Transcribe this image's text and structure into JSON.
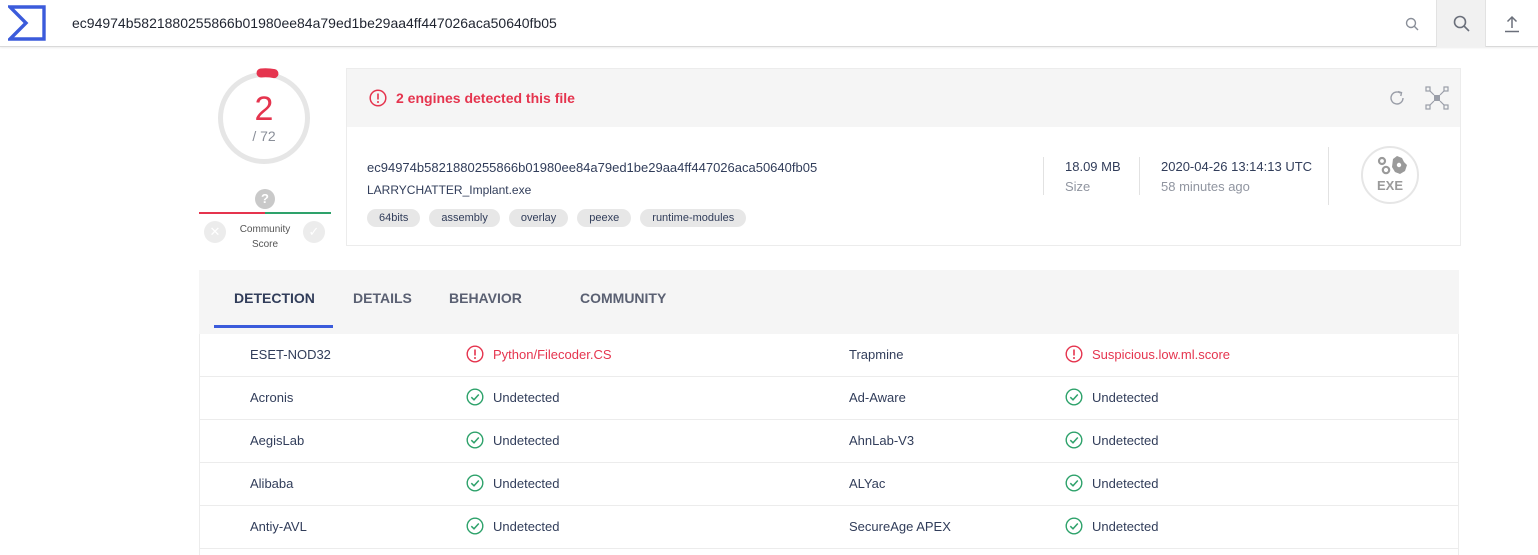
{
  "search": {
    "value": "ec94974b5821880255866b01980ee84a79ed1be29aa4ff447026aca50640fb05"
  },
  "score": {
    "detected": "2",
    "total": "/ 72"
  },
  "community": {
    "label_line1": "Community",
    "label_line2": "Score",
    "unknown": "?"
  },
  "summary": {
    "alert": "2 engines detected this file",
    "hash": "ec94974b5821880255866b01980ee84a79ed1be29aa4ff447026aca50640fb05",
    "filename": "LARRYCHATTER_Implant.exe",
    "tags": [
      "64bits",
      "assembly",
      "overlay",
      "peexe",
      "runtime-modules"
    ],
    "size_value": "18.09 MB",
    "size_label": "Size",
    "date_value": "2020-04-26 13:14:13 UTC",
    "date_label": "58 minutes ago",
    "filetype": "EXE"
  },
  "tabs": [
    "DETECTION",
    "DETAILS",
    "BEHAVIOR",
    "COMMUNITY"
  ],
  "detections": [
    {
      "left_engine": "ESET-NOD32",
      "left_result": "Python/Filecoder.CS",
      "left_status": "bad",
      "right_engine": "Trapmine",
      "right_result": "Suspicious.low.ml.score",
      "right_status": "bad"
    },
    {
      "left_engine": "Acronis",
      "left_result": "Undetected",
      "left_status": "ok",
      "right_engine": "Ad-Aware",
      "right_result": "Undetected",
      "right_status": "ok"
    },
    {
      "left_engine": "AegisLab",
      "left_result": "Undetected",
      "left_status": "ok",
      "right_engine": "AhnLab-V3",
      "right_result": "Undetected",
      "right_status": "ok"
    },
    {
      "left_engine": "Alibaba",
      "left_result": "Undetected",
      "left_status": "ok",
      "right_engine": "ALYac",
      "right_result": "Undetected",
      "right_status": "ok"
    },
    {
      "left_engine": "Antiy-AVL",
      "left_result": "Undetected",
      "left_status": "ok",
      "right_engine": "SecureAge APEX",
      "right_result": "Undetected",
      "right_status": "ok"
    }
  ],
  "colors": {
    "accent": "#3b5bdb",
    "malicious": "#e5344e",
    "clean": "#2ea26b"
  }
}
